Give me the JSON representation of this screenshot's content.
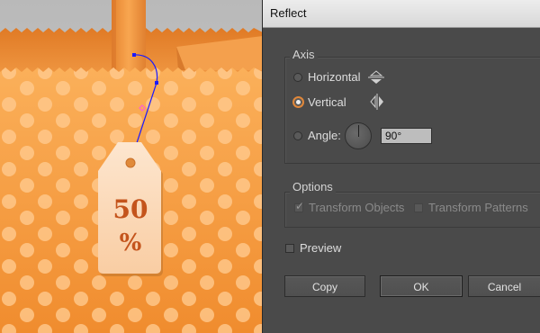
{
  "tag": {
    "value": "50",
    "unit": "%"
  },
  "dialog": {
    "title": "Reflect",
    "axis": {
      "legend": "Axis",
      "horizontal_label": "Horizontal",
      "vertical_label": "Vertical",
      "angle_label": "Angle:",
      "angle_value": "90°",
      "selected": "vertical"
    },
    "options": {
      "legend": "Options",
      "transform_objects_label": "Transform Objects",
      "transform_objects_checked": true,
      "transform_patterns_label": "Transform Patterns",
      "transform_patterns_checked": false
    },
    "preview_label": "Preview",
    "preview_checked": false,
    "buttons": {
      "copy": "Copy",
      "ok": "OK",
      "cancel": "Cancel"
    }
  },
  "colors": {
    "accent": "#e0873a",
    "paper": "#f79c3c",
    "dot": "#ffcf9a",
    "tag": "#fde0c4",
    "tag_text": "#c4541c"
  }
}
